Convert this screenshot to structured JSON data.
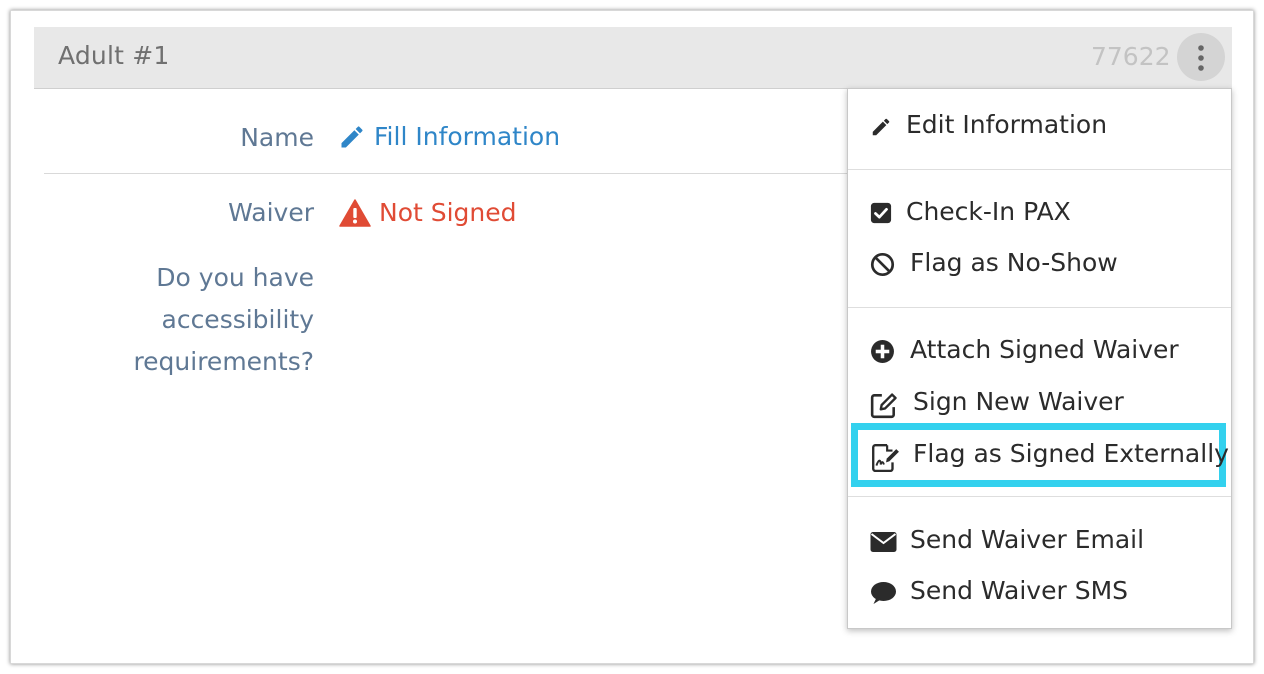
{
  "card": {
    "title": "Adult #1",
    "id": "77622"
  },
  "fields": {
    "name_label": "Name",
    "fill_info": "Fill Information",
    "waiver_label": "Waiver",
    "waiver_status": "Not Signed",
    "accessibility_label_line1": "Do you have",
    "accessibility_label_line2": "accessibility",
    "accessibility_label_line3": "requirements?"
  },
  "menu": {
    "edit_information": "Edit Information",
    "check_in_pax": "Check-In PAX",
    "flag_no_show": "Flag as No-Show",
    "attach_signed_waiver": "Attach Signed Waiver",
    "sign_new_waiver": "Sign New Waiver",
    "flag_signed_externally": "Flag as Signed Externally",
    "send_waiver_email": "Send Waiver Email",
    "send_waiver_sms": "Send Waiver SMS"
  },
  "colors": {
    "link": "#2f86c8",
    "danger": "#e04b35",
    "label": "#5f7894",
    "highlight": "#33d1ee"
  },
  "icons": {
    "kebab": "vertical-ellipsis-icon",
    "fill_info": "pencil-icon",
    "not_signed": "warning-triangle-icon",
    "edit_information": "pencil-icon",
    "check_in_pax": "checkbox-checked-icon",
    "flag_no_show": "ban-icon",
    "attach_signed_waiver": "plus-circle-icon",
    "sign_new_waiver": "edit-square-icon",
    "flag_signed_externally": "file-signature-icon",
    "send_waiver_email": "envelope-icon",
    "send_waiver_sms": "comment-icon"
  }
}
